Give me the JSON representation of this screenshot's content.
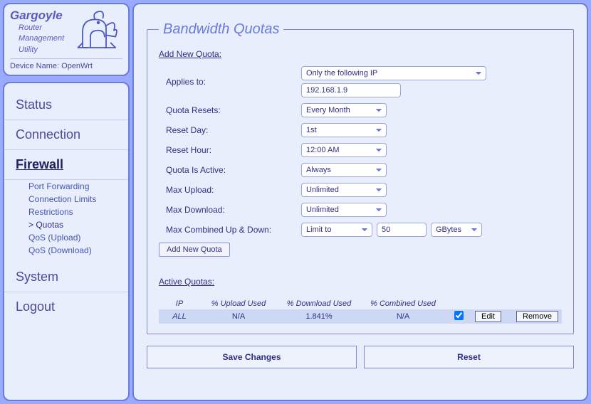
{
  "app": {
    "title": "Gargoyle",
    "subtitle_lines": [
      "Router",
      "Management",
      "Utility"
    ],
    "device_label": "Device Name:",
    "device_name": "OpenWrt"
  },
  "nav": {
    "items": [
      {
        "label": "Status",
        "active": false
      },
      {
        "label": "Connection",
        "active": false
      },
      {
        "label": "Firewall",
        "active": true,
        "sub": [
          {
            "label": "Port Forwarding",
            "selected": false
          },
          {
            "label": "Connection Limits",
            "selected": false
          },
          {
            "label": "Restrictions",
            "selected": false
          },
          {
            "label": "Quotas",
            "selected": true
          },
          {
            "label": "QoS (Upload)",
            "selected": false
          },
          {
            "label": "QoS (Download)",
            "selected": false
          }
        ]
      },
      {
        "label": "System",
        "active": false
      },
      {
        "label": "Logout",
        "active": false
      }
    ]
  },
  "panel": {
    "legend": "Bandwidth Quotas",
    "add_section": "Add New Quota:",
    "rows": {
      "applies_to": {
        "label": "Applies to:",
        "value": "Only the following IP",
        "ip": "192.168.1.9"
      },
      "quota_resets": {
        "label": "Quota Resets:",
        "value": "Every Month"
      },
      "reset_day": {
        "label": "Reset Day:",
        "value": "1st"
      },
      "reset_hour": {
        "label": "Reset Hour:",
        "value": "12:00 AM"
      },
      "quota_active": {
        "label": "Quota Is Active:",
        "value": "Always"
      },
      "max_upload": {
        "label": "Max Upload:",
        "value": "Unlimited"
      },
      "max_download": {
        "label": "Max Download:",
        "value": "Unlimited"
      },
      "max_combined": {
        "label": "Max Combined Up & Down:",
        "value": "Limit to",
        "amount": "50",
        "unit": "GBytes"
      }
    },
    "add_button": "Add New Quota",
    "active_section": "Active Quotas:",
    "table": {
      "headers": {
        "c1": "IP",
        "c2": "% Upload Used",
        "c3": "% Download Used",
        "c4": "% Combined Used"
      },
      "row": {
        "ip": "ALL",
        "upload": "N/A",
        "download": "1.841%",
        "combined": "N/A",
        "checked": true,
        "edit": "Edit",
        "remove": "Remove"
      }
    },
    "save": "Save Changes",
    "reset": "Reset"
  }
}
